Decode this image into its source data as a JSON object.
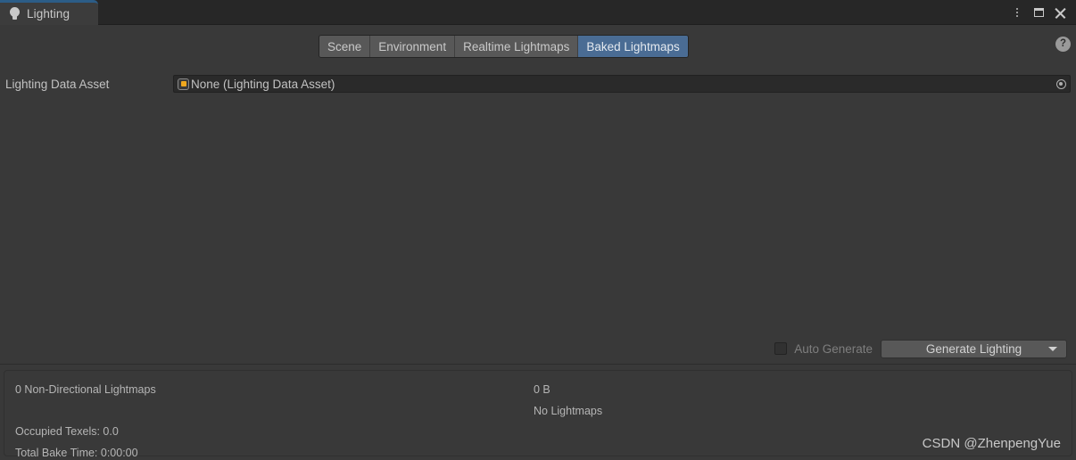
{
  "window": {
    "tab_title": "Lighting",
    "tab_icon": "lightbulb-icon",
    "controls": {
      "menu": "kebab-menu-icon",
      "maximize": "maximize-icon",
      "close": "close-icon"
    }
  },
  "toolbar": {
    "tabs": [
      {
        "label": "Scene",
        "selected": false
      },
      {
        "label": "Environment",
        "selected": false
      },
      {
        "label": "Realtime Lightmaps",
        "selected": false
      },
      {
        "label": "Baked Lightmaps",
        "selected": true
      }
    ],
    "help": "?"
  },
  "properties": {
    "lighting_data_asset": {
      "label": "Lighting Data Asset",
      "value": "None (Lighting Data Asset)",
      "picker": "object-picker-icon"
    }
  },
  "generate": {
    "auto_generate_label": "Auto Generate",
    "auto_generate_checked": false,
    "generate_button_label": "Generate Lighting",
    "dropdown_caret": "caret-down-icon"
  },
  "status": {
    "lightmaps_count": "0 Non-Directional Lightmaps",
    "size": "0 B",
    "lightmaps_state": "No Lightmaps",
    "occupied_texels": "Occupied Texels: 0.0",
    "total_bake_time": "Total Bake Time: 0:00:00"
  },
  "watermark": "CSDN @ZhenpengYue",
  "colors": {
    "window_background": "#393939",
    "titlebar": "#272727",
    "tab_accent": "#2c5d87",
    "tab_selected": "#4a6c94",
    "tab_unselected": "#585858",
    "field_background": "#2a2a2a",
    "asset_icon": "#f0a81e"
  }
}
